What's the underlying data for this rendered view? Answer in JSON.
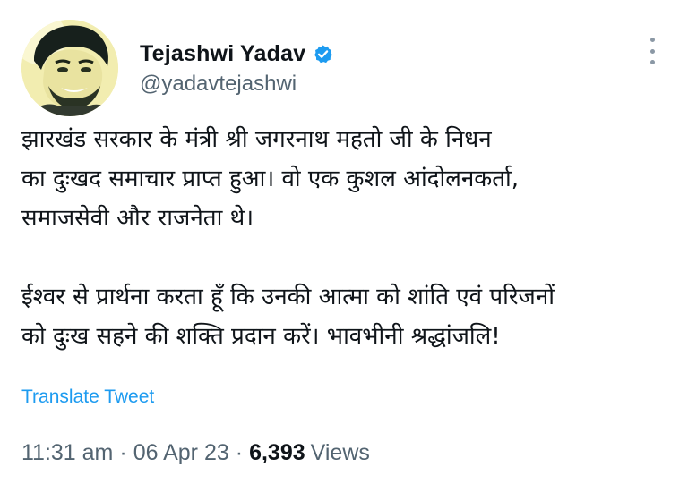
{
  "author": {
    "display_name": "Tejashwi Yadav",
    "handle": "@yadavtejashwi",
    "verified": true,
    "verified_color": "#1d9bf0"
  },
  "tweet": {
    "paragraphs": [
      "झारखंड सरकार के मंत्री श्री जगरनाथ महतो जी के निधन\nका दुःखद समाचार प्राप्त हुआ। वो एक कुशल आंदोलनकर्ता,\nसमाजसेवी और राजनेता थे।",
      "ईश्वर से प्रार्थना करता हूँ कि उनकी आत्मा को शांति एवं परिजनों\nको दुःख सहने की शक्ति प्रदान करें। भावभीनी श्रद्धांजलि!"
    ],
    "translate_label": "Translate Tweet"
  },
  "meta": {
    "time": "11:31 am",
    "separator": "·",
    "date": "06 Apr 23",
    "views_count": "6,393",
    "views_label": "Views"
  },
  "icons": {
    "more": "more-options-icon",
    "verified": "verified-badge-icon"
  },
  "colors": {
    "link": "#1d9bf0",
    "secondary_text": "#536471",
    "primary_text": "#0f1419"
  }
}
